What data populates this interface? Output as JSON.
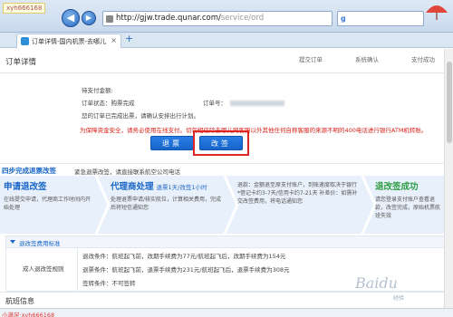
{
  "browser": {
    "url": "http://gjw.trade.qunar.com/",
    "url_dim": "service/ord",
    "tab_title": "订单详情-国内机票-去哪儿",
    "watermark": "xyh666168"
  },
  "page": {
    "title": "订单详情",
    "steps": [
      "提交订单",
      "系统确认",
      "支付成功"
    ]
  },
  "order": {
    "amount_label": "待支付金额:",
    "status_label": "订单状态：",
    "status_value": "购票完成",
    "order_no_label": "订单号：",
    "note": "您的订单已完成出票，请确认安排出行计划。",
    "warning": "为保障资金安全，请务必使用在线支付。切勿相信除去哪儿网客服以外其他任何自称客服的来源不明的400电话进行银行ATM机转账。",
    "refund_button": "退票",
    "change_button": "改签"
  },
  "guide": {
    "title": "四步完成退票改签",
    "subtitle": "紧急退票改签，请直接联系航空公司电话"
  },
  "cards": [
    {
      "title": "申请退改签",
      "sub": "",
      "text": "在线提交申请，代理商工作时间内开始处理"
    },
    {
      "title": "代理商处理",
      "sub": "退票1天/改签1小时",
      "text": "处理退票申请/核实航位，计算相关费用，完成后将短信通知您"
    },
    {
      "title": "",
      "sub": "",
      "text": "退款：金额退至原支付账户，到账速度取决于银行 *借记卡约3-7天/信用卡约7-21天 补差价：如需补交改签费用，将电话通知您"
    },
    {
      "title": "退改签成功",
      "sub": "",
      "text": "请您登录支付账户查看退款，改签完成，原始机票航班失效"
    }
  ],
  "rules": {
    "header": "退改签费用标准",
    "label": "成人退改签规则",
    "lines": [
      "退改条件：航班起飞前，改期手续费为77元/航班起飞后，改期手续费为154元",
      "退票条件：航班起飞前，退票手续费为231元/航班起飞后，退票手续费为308元",
      "签转条件：不可签转"
    ]
  },
  "flight": {
    "title": "航班信息"
  },
  "status": {
    "watermark": "小满足·xyh666168"
  },
  "overlay": {
    "brand": "Baidu",
    "sub": "经验"
  }
}
